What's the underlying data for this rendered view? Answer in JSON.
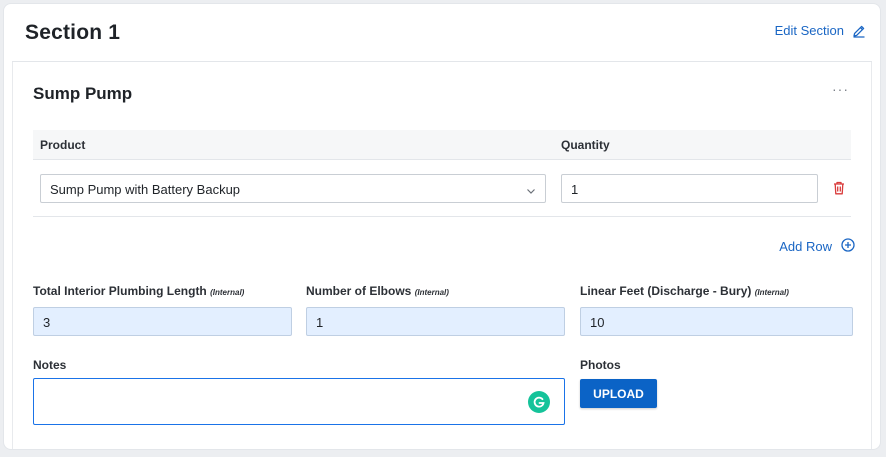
{
  "section": {
    "title": "Section 1",
    "edit_label": "Edit Section"
  },
  "item": {
    "title": "Sump Pump",
    "more_label": "···"
  },
  "table": {
    "headers": {
      "product": "Product",
      "quantity": "Quantity"
    },
    "rows": [
      {
        "product": "Sump Pump with Battery Backup",
        "quantity": "1"
      }
    ],
    "add_row_label": "Add Row"
  },
  "fields": [
    {
      "label": "Total Interior Plumbing Length",
      "suffix": "(Internal)",
      "value": "3"
    },
    {
      "label": "Number of Elbows",
      "suffix": "(Internal)",
      "value": "1"
    },
    {
      "label": "Linear Feet (Discharge - Bury)",
      "suffix": "(Internal)",
      "value": "10"
    }
  ],
  "notes": {
    "label": "Notes",
    "value": ""
  },
  "photos": {
    "label": "Photos",
    "upload_label": "UPLOAD"
  },
  "colors": {
    "accent": "#1a66c4",
    "danger": "#d93a3a",
    "input_fill": "#e3efff",
    "button": "#0b63c6"
  },
  "icons": {
    "edit": "pencil-icon",
    "more": "more-horizontal-icon",
    "select": "chevron-down-icon",
    "delete": "trash-icon",
    "add": "plus-circle-icon",
    "grammarly": "grammarly-icon"
  }
}
